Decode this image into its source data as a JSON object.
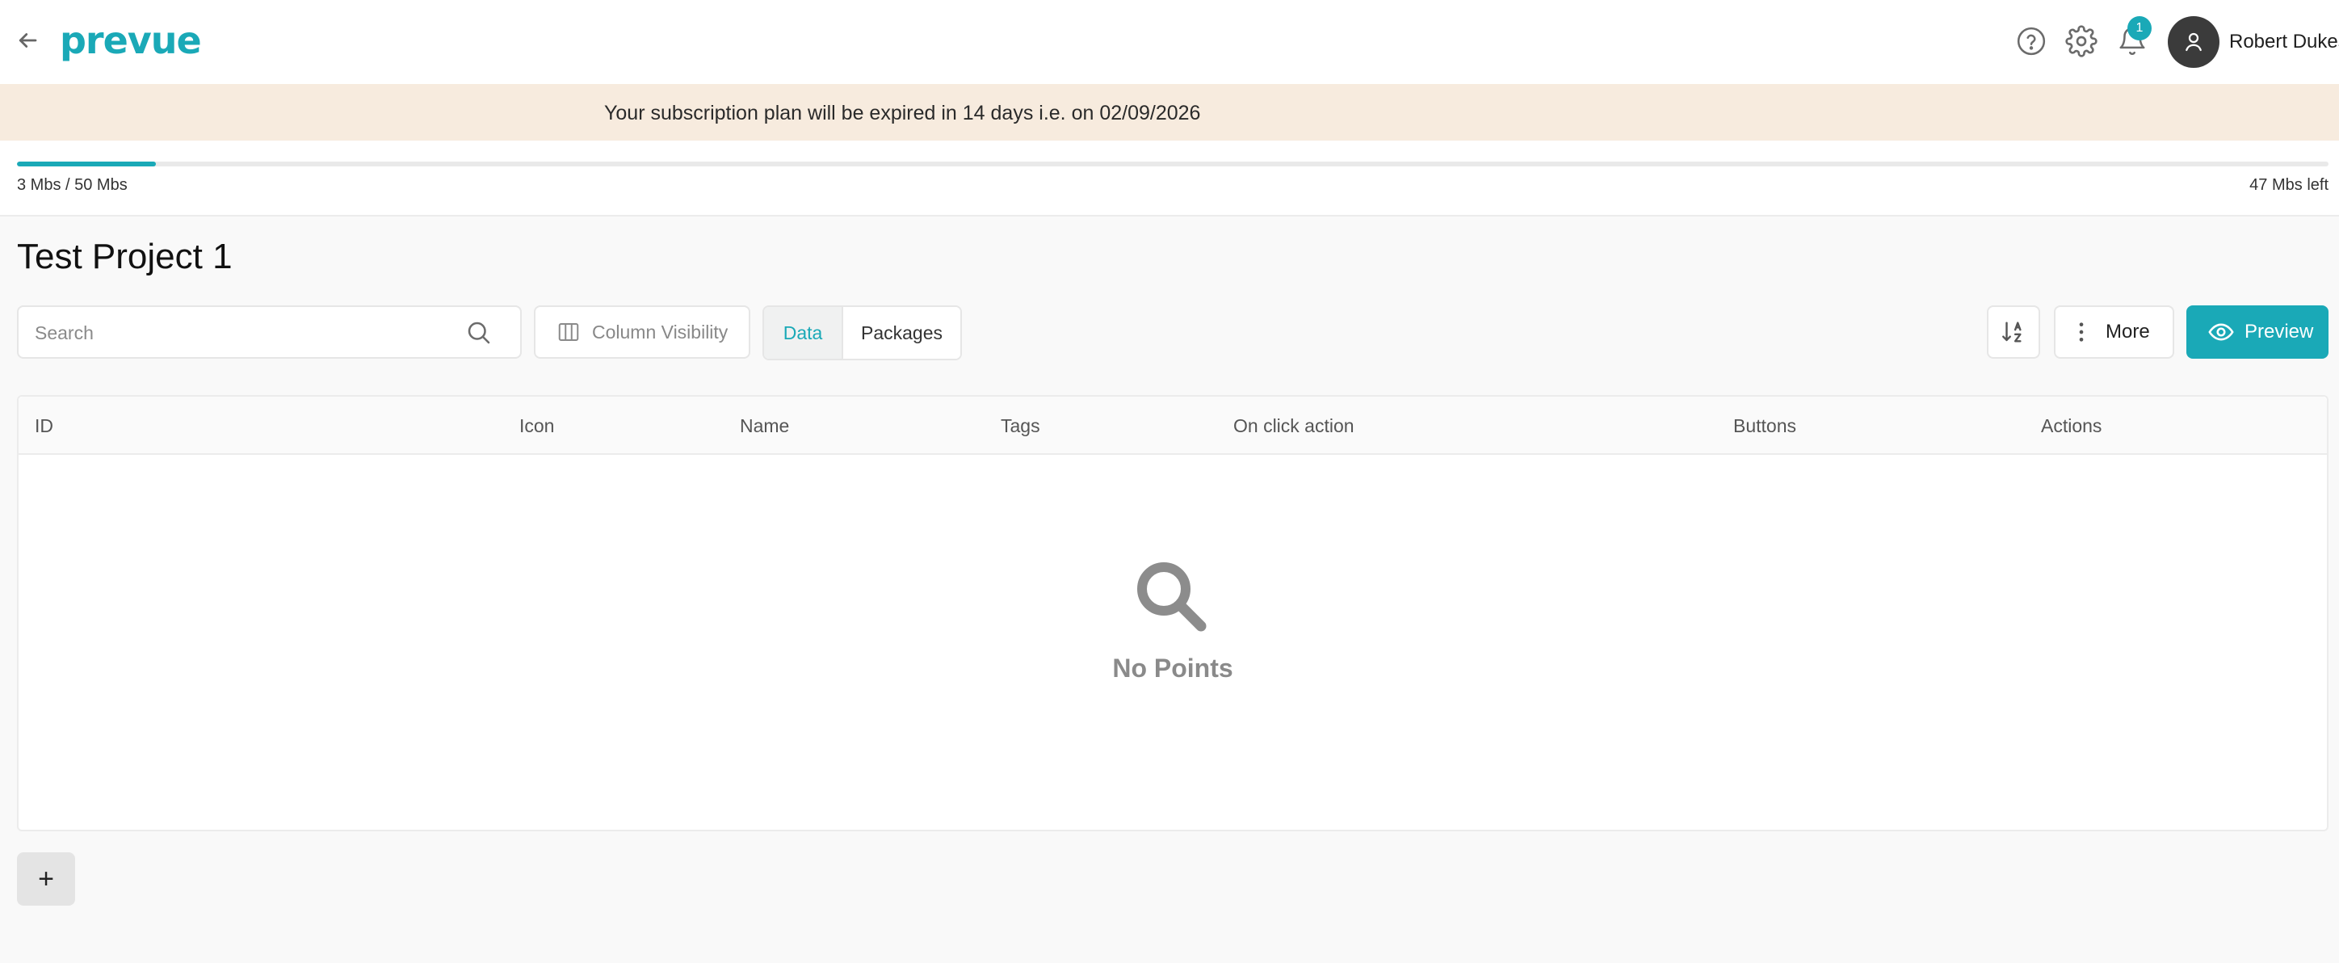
{
  "header": {
    "logo": "prevue",
    "notification_count": "1",
    "user_name": "Robert Dukes",
    "icons": [
      "back-arrow-icon",
      "help-icon",
      "settings-gear-icon",
      "bell-icon",
      "user-icon"
    ]
  },
  "banner": {
    "text": "Your subscription plan will be expired in 14 days i.e. on 02/09/2026"
  },
  "storage": {
    "used_label": "3 Mbs / 50 Mbs",
    "left_label": "47 Mbs left",
    "used_fraction": 0.06
  },
  "page": {
    "title": "Test Project 1"
  },
  "toolbar": {
    "search_placeholder": "Search",
    "search_value": "",
    "column_visibility_label": "Column Visibility",
    "tabs": [
      {
        "label": "Data",
        "active": true
      },
      {
        "label": "Packages",
        "active": false
      }
    ],
    "more_label": "More",
    "preview_label": "Preview"
  },
  "table": {
    "columns": [
      "ID",
      "Icon",
      "Name",
      "Tags",
      "On click action",
      "Buttons",
      "Actions"
    ],
    "rows": [],
    "empty_text": "No Points"
  },
  "footer": {
    "add_label": "+"
  },
  "colors": {
    "accent": "#1aa9b7",
    "banner_bg": "#f7ebde",
    "avatar_bg": "#3b3b3b"
  }
}
